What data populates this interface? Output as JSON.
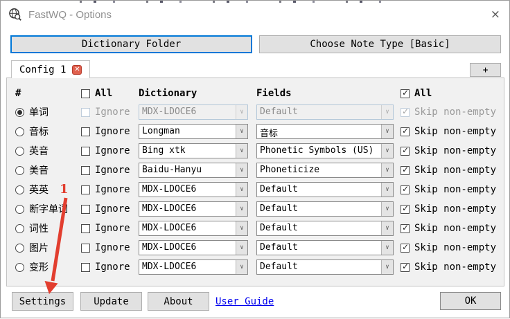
{
  "window": {
    "title": "FastWQ - Options",
    "close_glyph": "×"
  },
  "toolbar": {
    "dictionary_folder": "Dictionary Folder",
    "choose_note_type": "Choose Note Type [Basic]"
  },
  "tabs": {
    "active_label": "Config 1",
    "close_glyph": "✕",
    "add_label": "+"
  },
  "table": {
    "headers": {
      "index": "#",
      "all_left": "All",
      "dictionary": "Dictionary",
      "fields": "Fields",
      "all_right": "All"
    },
    "header_all_left_checked": false,
    "header_all_right_checked": true,
    "ignore_label": "Ignore",
    "skip_label": "Skip non-empty",
    "rows": [
      {
        "name": "单词",
        "selected": true,
        "disabled": true,
        "ignore_checked": false,
        "dictionary": "MDX-LDOCE6",
        "field": "Default",
        "skip_checked": true
      },
      {
        "name": "音标",
        "selected": false,
        "disabled": false,
        "ignore_checked": false,
        "dictionary": "Longman",
        "field": "音标",
        "skip_checked": true
      },
      {
        "name": "英音",
        "selected": false,
        "disabled": false,
        "ignore_checked": false,
        "dictionary": "Bing xtk",
        "field": "Phonetic Symbols (US)",
        "skip_checked": true
      },
      {
        "name": "美音",
        "selected": false,
        "disabled": false,
        "ignore_checked": false,
        "dictionary": "Baidu-Hanyu",
        "field": "Phoneticize",
        "skip_checked": true
      },
      {
        "name": "英英",
        "selected": false,
        "disabled": false,
        "ignore_checked": false,
        "dictionary": "MDX-LDOCE6",
        "field": "Default",
        "skip_checked": true,
        "annotation": "1"
      },
      {
        "name": "断字单词",
        "selected": false,
        "disabled": false,
        "ignore_checked": false,
        "dictionary": "MDX-LDOCE6",
        "field": "Default",
        "skip_checked": true
      },
      {
        "name": "词性",
        "selected": false,
        "disabled": false,
        "ignore_checked": false,
        "dictionary": "MDX-LDOCE6",
        "field": "Default",
        "skip_checked": true
      },
      {
        "name": "图片",
        "selected": false,
        "disabled": false,
        "ignore_checked": false,
        "dictionary": "MDX-LDOCE6",
        "field": "Default",
        "skip_checked": true
      },
      {
        "name": "变形",
        "selected": false,
        "disabled": false,
        "ignore_checked": false,
        "dictionary": "MDX-LDOCE6",
        "field": "Default",
        "skip_checked": true
      }
    ]
  },
  "footer": {
    "settings": "Settings",
    "update": "Update",
    "about": "About",
    "user_guide": "User Guide",
    "ok": "OK"
  },
  "colors": {
    "accent_focus": "#0078d7",
    "link": "#0000ee",
    "tab_close_red": "#e0604e",
    "annotation_red": "#e23e2f"
  }
}
